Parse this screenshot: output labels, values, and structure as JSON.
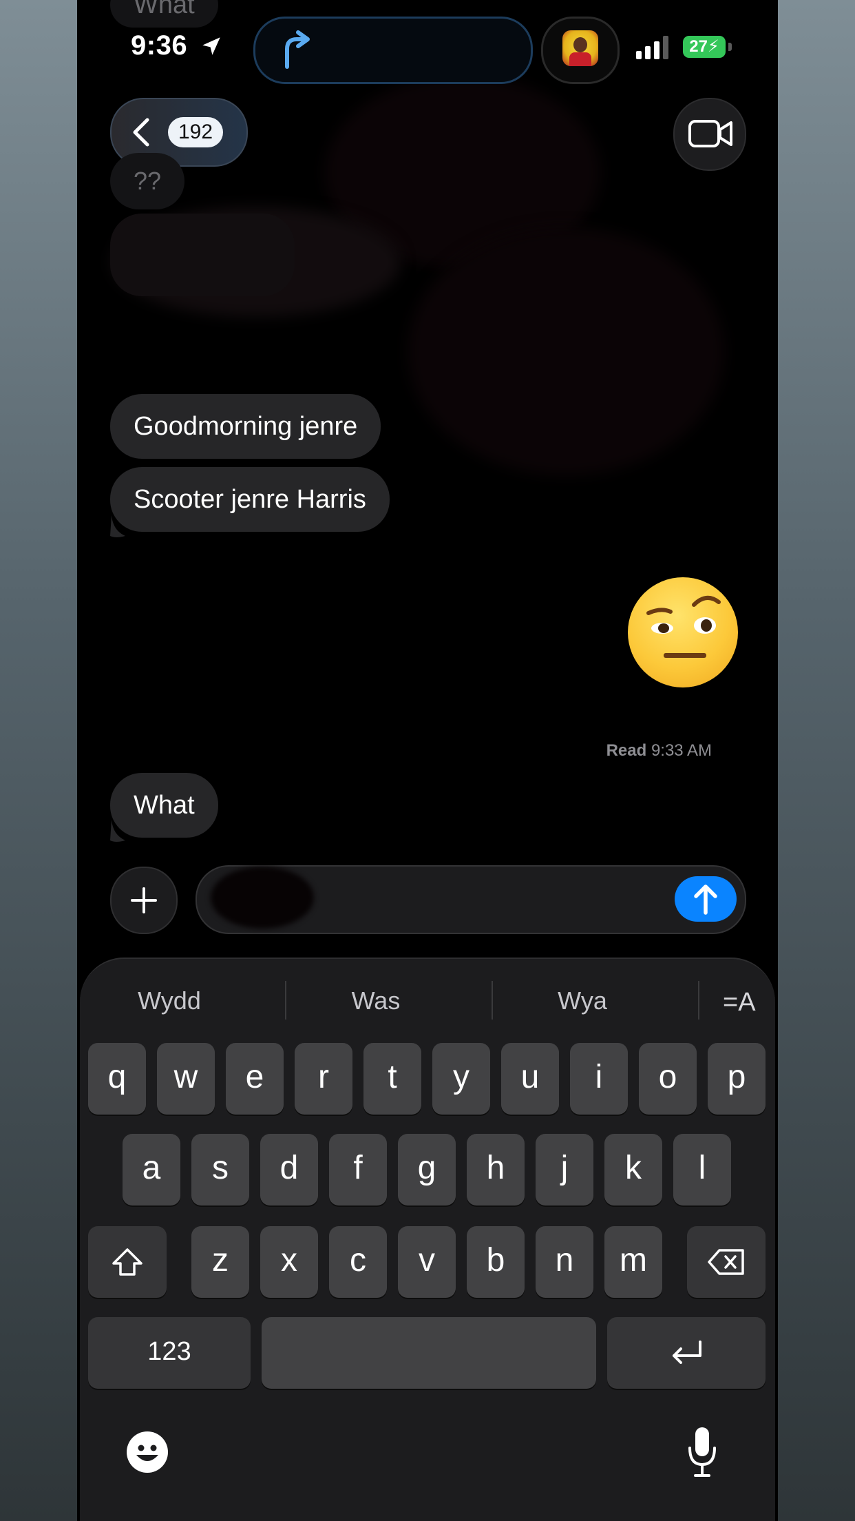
{
  "status_bar": {
    "time": "9:36",
    "battery": "27",
    "battery_color": "#34c759"
  },
  "nav": {
    "unread_count": "192",
    "back_icon": "chevron-left-icon",
    "video_icon": "video-camera-icon"
  },
  "messages": {
    "top_faded_1": "What",
    "top_faded_2": "??",
    "incoming_1": "Goodmorning jenre",
    "incoming_2": "Scooter jenre Harris",
    "outgoing_emoji": "face-with-raised-eyebrow-emoji",
    "read_label": "Read",
    "read_time": "9:33 AM",
    "incoming_3": "What"
  },
  "composer": {
    "plus_icon": "plus-icon",
    "send_icon": "arrow-up-icon",
    "send_color": "#0a84ff"
  },
  "keyboard": {
    "suggestions": [
      "Wydd",
      "Was",
      "Wya"
    ],
    "format_icon": "=A",
    "row1": [
      "q",
      "w",
      "e",
      "r",
      "t",
      "y",
      "u",
      "i",
      "o",
      "p"
    ],
    "row2": [
      "a",
      "s",
      "d",
      "f",
      "g",
      "h",
      "j",
      "k",
      "l"
    ],
    "row3": [
      "z",
      "x",
      "c",
      "v",
      "b",
      "n",
      "m"
    ],
    "numbers_key": "123",
    "emoji_icon": "emoji-icon",
    "mic_icon": "microphone-icon"
  }
}
